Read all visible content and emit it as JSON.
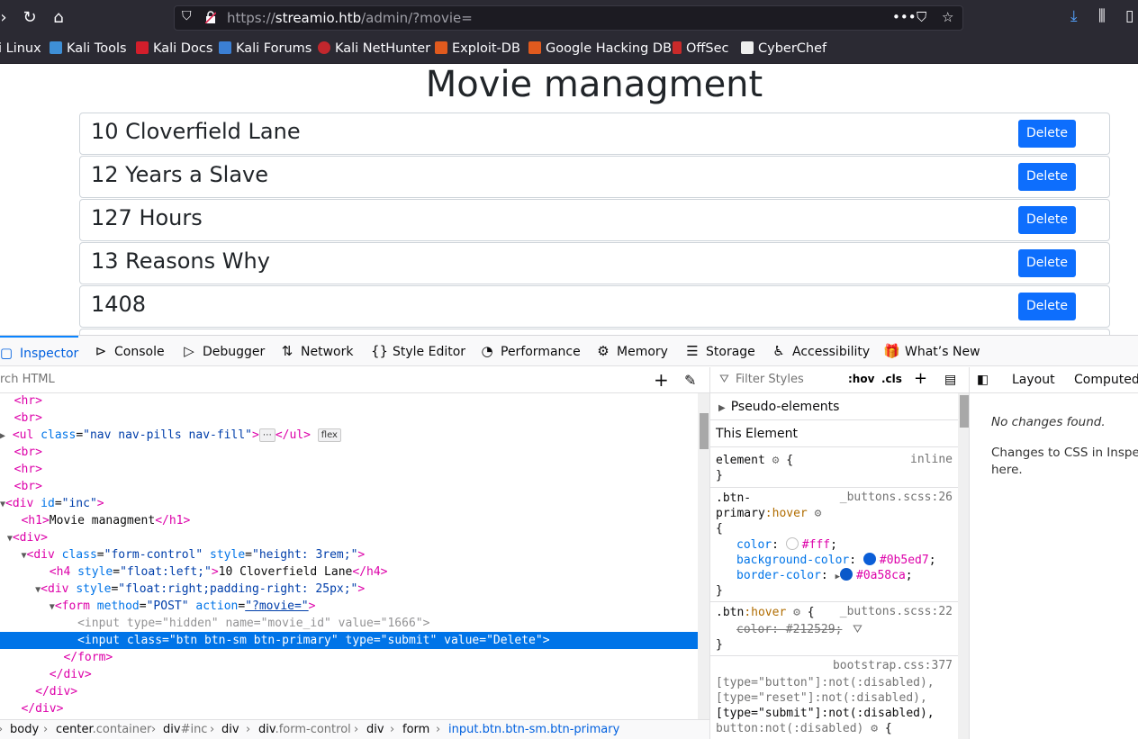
{
  "browser": {
    "url_prefix": "https://",
    "url_host": "streamio.htb",
    "url_path": "/admin/?movie=",
    "bookmarks": [
      "i Linux",
      "Kali Tools",
      "Kali Docs",
      "Kali Forums",
      "Kali NetHunter",
      "Exploit-DB",
      "Google Hacking DB",
      "OffSec",
      "CyberChef"
    ]
  },
  "page": {
    "title": "Movie managment",
    "movies": [
      {
        "title": "10 Cloverfield Lane",
        "button": "Delete"
      },
      {
        "title": "12 Years a Slave",
        "button": "Delete"
      },
      {
        "title": "127 Hours",
        "button": "Delete"
      },
      {
        "title": "13 Reasons Why",
        "button": "Delete"
      },
      {
        "title": "1408",
        "button": "Delete"
      }
    ]
  },
  "devtools": {
    "tabs": [
      "Inspector",
      "Console",
      "Debugger",
      "Network",
      "Style Editor",
      "Performance",
      "Memory",
      "Storage",
      "Accessibility",
      "What’s New"
    ],
    "search_placeholder": "rch HTML",
    "breadcrumbs": [
      {
        "el": "body",
        "cls": ""
      },
      {
        "el": "center",
        "cls": ".container"
      },
      {
        "el": "div",
        "cls": "#inc"
      },
      {
        "el": "div",
        "cls": ""
      },
      {
        "el": "div",
        "cls": ".form-control"
      },
      {
        "el": "div",
        "cls": ""
      },
      {
        "el": "form",
        "cls": ""
      },
      {
        "el": "input.btn.btn-sm.btn-primary",
        "cls": ""
      }
    ],
    "rules": {
      "filter_placeholder": "Filter Styles",
      "hov": ":hov",
      "cls": ".cls",
      "pseudo": "Pseudo-elements",
      "this_element": "This Element",
      "element_src": "inline",
      "r1_src": "_buttons.scss:26",
      "r2_src": "_buttons.scss:22",
      "r3_src": "bootstrap.css:377"
    },
    "changes": {
      "tab_layout": "Layout",
      "tab_computed": "Computed",
      "no_changes": "No changes found.",
      "desc_1": "Changes to CSS in Inspect",
      "desc_2": "here."
    }
  }
}
